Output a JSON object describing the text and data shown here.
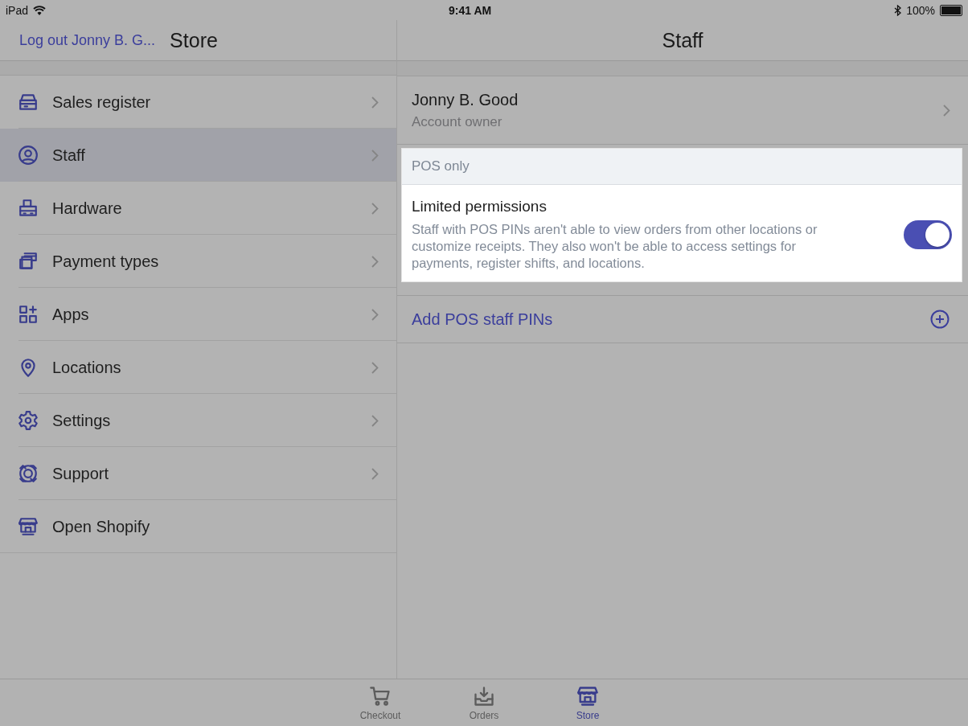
{
  "status_bar": {
    "device": "iPad",
    "time": "9:41 AM",
    "battery": "100%"
  },
  "master": {
    "back_link": "Log out Jonny B. G...",
    "title": "Store",
    "items": [
      {
        "label": "Sales register",
        "selected": false,
        "chevron": true
      },
      {
        "label": "Staff",
        "selected": true,
        "chevron": true
      },
      {
        "label": "Hardware",
        "selected": false,
        "chevron": true
      },
      {
        "label": "Payment types",
        "selected": false,
        "chevron": true
      },
      {
        "label": "Apps",
        "selected": false,
        "chevron": true
      },
      {
        "label": "Locations",
        "selected": false,
        "chevron": true
      },
      {
        "label": "Settings",
        "selected": false,
        "chevron": true
      },
      {
        "label": "Support",
        "selected": false,
        "chevron": true
      },
      {
        "label": "Open Shopify",
        "selected": false,
        "chevron": false
      }
    ]
  },
  "detail": {
    "title": "Staff",
    "owner": {
      "name": "Jonny B. Good",
      "role": "Account owner"
    },
    "section": {
      "header": "POS only",
      "title": "Limited permissions",
      "description": "Staff with POS PINs aren't able to view orders from other locations or customize receipts. They also won't be able to access settings for payments, register shifts, and locations.",
      "on": true
    },
    "add_action": "Add POS staff PINs"
  },
  "tab_bar": [
    {
      "label": "Checkout",
      "selected": false
    },
    {
      "label": "Orders",
      "selected": false
    },
    {
      "label": "Store",
      "selected": true
    }
  ]
}
